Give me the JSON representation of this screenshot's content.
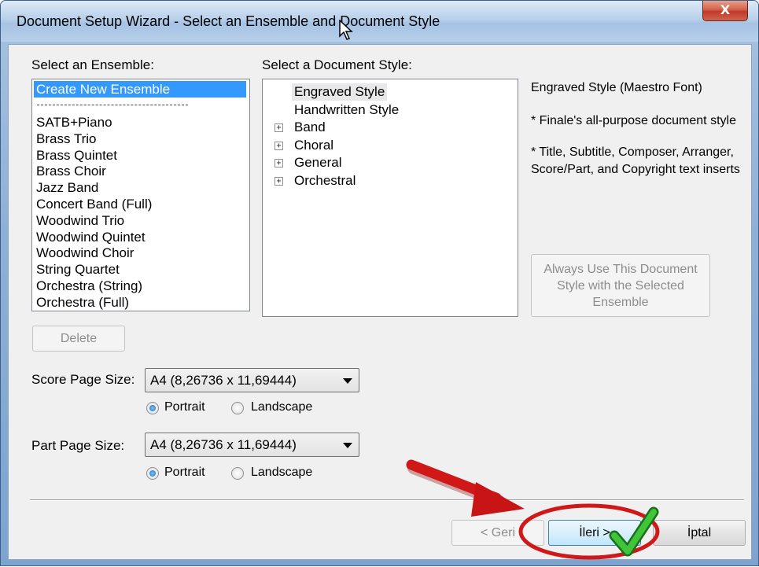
{
  "window": {
    "title": "Document Setup Wizard - Select an Ensemble and Document Style",
    "close_label": "X"
  },
  "ensemble": {
    "label": "Select an Ensemble:",
    "items": [
      "Create New Ensemble",
      "SATB+Piano",
      "Brass Trio",
      "Brass Quintet",
      "Brass Choir",
      "Jazz Band",
      "Concert Band (Full)",
      "Woodwind Trio",
      "Woodwind Quintet",
      "Woodwind Choir",
      "String Quartet",
      "Orchestra (String)",
      "Orchestra (Full)"
    ],
    "delete_label": "Delete"
  },
  "style": {
    "label": "Select a Document Style:",
    "items": [
      {
        "label": "Engraved Style",
        "expandable": false
      },
      {
        "label": "Handwritten Style",
        "expandable": false
      },
      {
        "label": "Band",
        "expandable": true
      },
      {
        "label": "Choral",
        "expandable": true
      },
      {
        "label": "General",
        "expandable": true
      },
      {
        "label": "Orchestral",
        "expandable": true
      }
    ],
    "expand_symbol": "+"
  },
  "description": {
    "title": "Engraved Style (Maestro Font)",
    "line1": "* Finale's all-purpose document style",
    "line2": "* Title, Subtitle, Composer, Arranger, Score/Part, and Copyright text inserts",
    "always_use_label": "Always Use This Document Style with the Selected Ensemble"
  },
  "score_page": {
    "label": "Score Page Size:",
    "value": "A4 (8,26736 x 11,69444)",
    "portrait": "Portrait",
    "landscape": "Landscape",
    "orientation": "Portrait"
  },
  "part_page": {
    "label": "Part Page Size:",
    "value": "A4 (8,26736 x 11,69444)",
    "portrait": "Portrait",
    "landscape": "Landscape",
    "orientation": "Portrait"
  },
  "nav": {
    "back_label": "< Geri",
    "next_label": "İleri >",
    "cancel_label": "İptal"
  },
  "colors": {
    "selection": "#3399ff",
    "annotation_red": "#d01818",
    "check_green": "#2fae2a"
  }
}
